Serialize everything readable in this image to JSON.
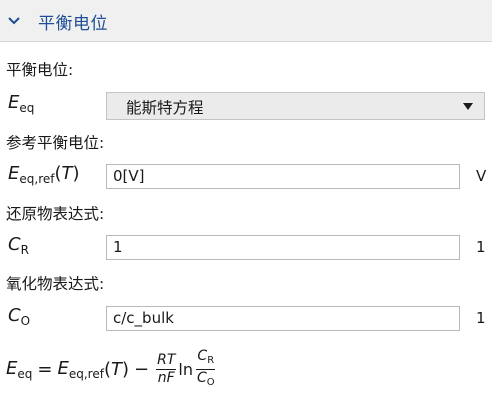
{
  "section": {
    "title": "平衡电位",
    "chevron_icon": "chevron-down-icon"
  },
  "rows": {
    "eq_method": {
      "label": "平衡电位:",
      "symbol_main": "E",
      "symbol_sub": "eq",
      "selected": "能斯特方程"
    },
    "eq_ref": {
      "label": "参考平衡电位:",
      "symbol_main": "E",
      "symbol_sub": "eq,ref",
      "symbol_arg": "T",
      "value": "0[V]",
      "unit": "V"
    },
    "reduced": {
      "label": "还原物表达式:",
      "symbol_main": "C",
      "symbol_sub": "R",
      "value": "1",
      "unit": "1"
    },
    "oxidized": {
      "label": "氧化物表达式:",
      "symbol_main": "C",
      "symbol_sub": "O",
      "value": "c/c_bulk",
      "unit": "1"
    }
  },
  "equation": {
    "lhs_main": "E",
    "lhs_sub": "eq",
    "equals": "=",
    "ref_main": "E",
    "ref_sub": "eq,ref",
    "ref_arg": "T",
    "minus": "−",
    "frac1_num": "RT",
    "frac1_den": "nF",
    "ln": "ln",
    "frac2_num_main": "C",
    "frac2_num_sub": "R",
    "frac2_den_main": "C",
    "frac2_den_sub": "O"
  },
  "colors": {
    "header_bg": "#f0f0f0",
    "header_title": "#1f4e96",
    "select_bg": "#ebebeb"
  }
}
